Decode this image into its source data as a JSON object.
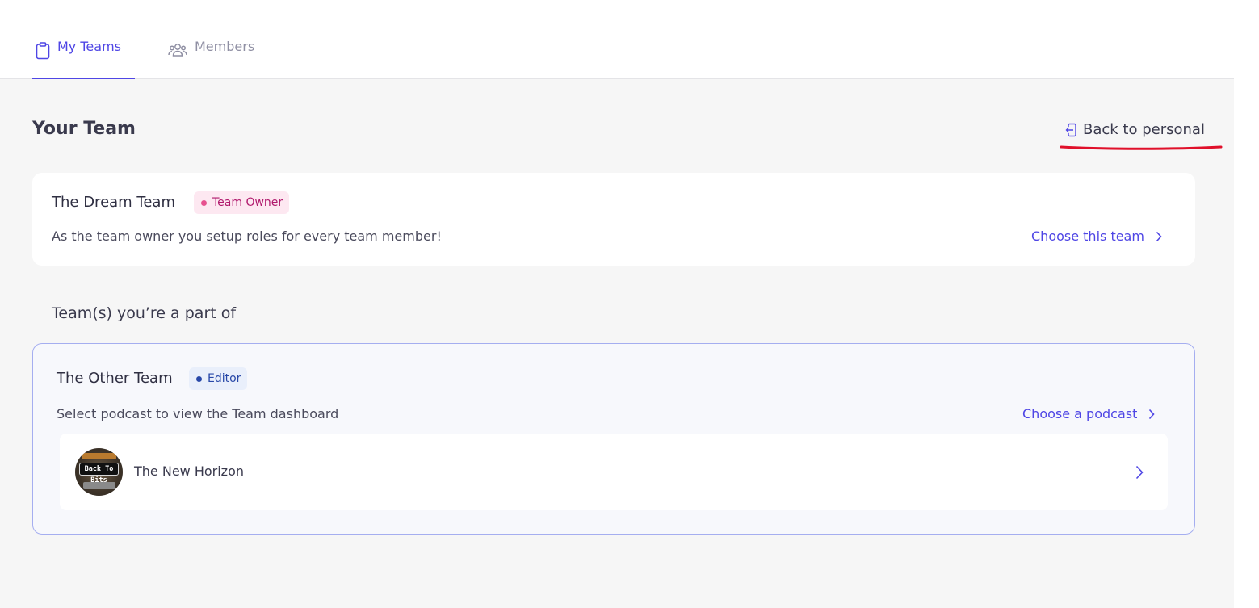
{
  "tabs": [
    {
      "label": "My Teams",
      "icon": "clipboard-icon",
      "active": true
    },
    {
      "label": "Members",
      "icon": "users-icon",
      "active": false
    }
  ],
  "header": {
    "title": "Your Team",
    "back_label": "Back to personal",
    "back_icon": "sign-in-icon"
  },
  "owner_team": {
    "name": "The Dream Team",
    "role": "Team Owner",
    "description": "As the team owner you setup roles for every team member!",
    "action_label": "Choose this team"
  },
  "member_section": {
    "title": "Team(s) you’re a part of",
    "teams": [
      {
        "name": "The Other Team",
        "role": "Editor",
        "description": "Select podcast to view the Team dashboard",
        "action_label": "Choose a podcast",
        "podcasts": [
          {
            "name": "The New Horizon",
            "cover_text": "Back To Bits"
          }
        ]
      }
    ]
  },
  "colors": {
    "accent": "#4f46e5",
    "owner_badge_bg": "#fde8f1",
    "editor_badge_bg": "#e9effb",
    "annotation_red": "#e0102a"
  }
}
